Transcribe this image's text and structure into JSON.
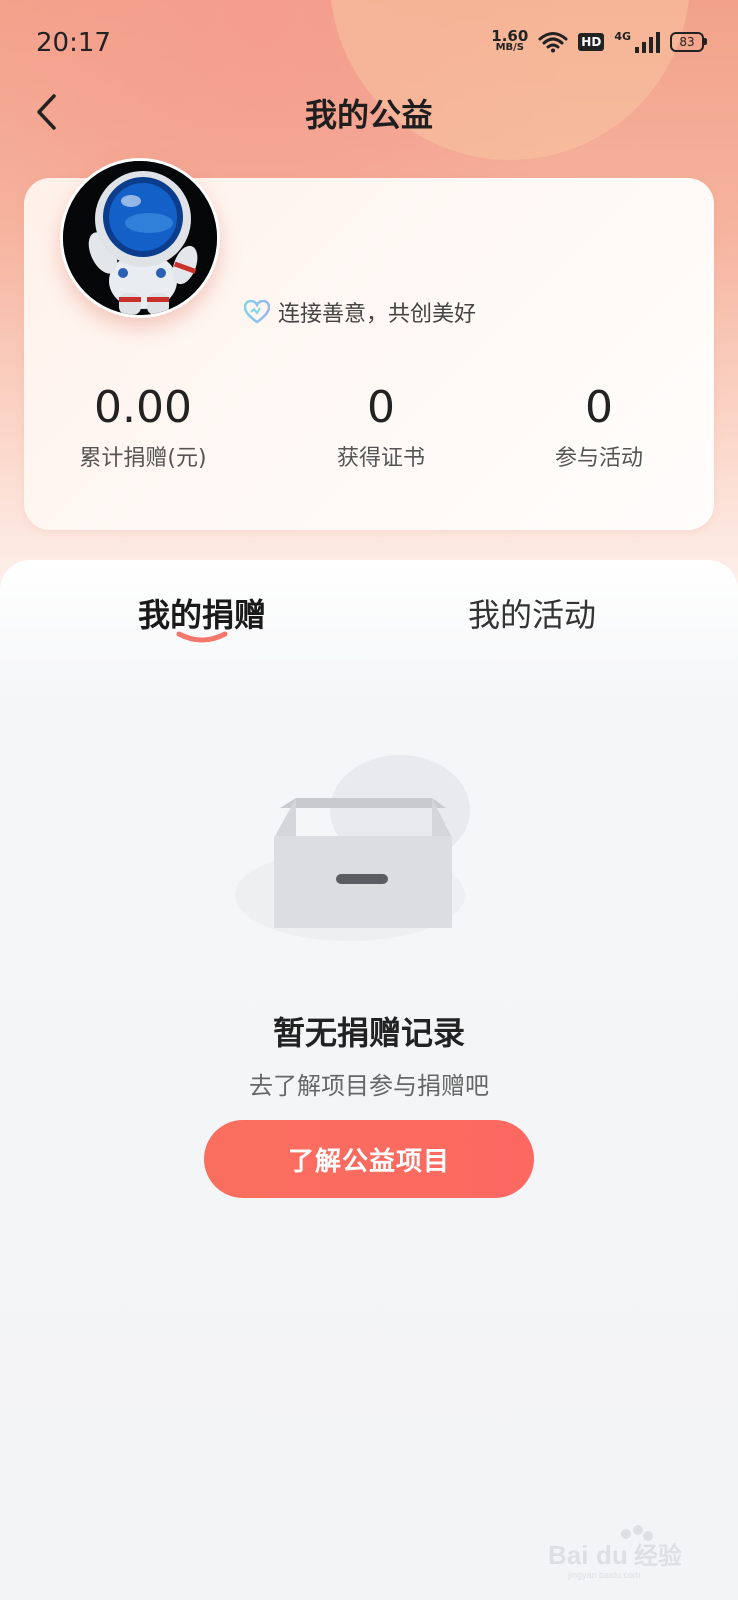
{
  "status_bar": {
    "time": "20:17",
    "speed_value": "1.60",
    "speed_unit": "MB/S",
    "hd": "HD",
    "network": "4G",
    "battery": "83"
  },
  "header": {
    "title": "我的公益"
  },
  "profile": {
    "slogan": "连接善意，共创美好",
    "stats": [
      {
        "value": "0.00",
        "label": "累计捐赠(元)"
      },
      {
        "value": "0",
        "label": "获得证书"
      },
      {
        "value": "0",
        "label": "参与活动"
      }
    ]
  },
  "tabs": [
    {
      "label": "我的捐赠",
      "active": true
    },
    {
      "label": "我的活动",
      "active": false
    }
  ],
  "empty_state": {
    "title": "暂无捐赠记录",
    "subtitle": "去了解项目参与捐赠吧",
    "button_label": "了解公益项目"
  },
  "watermark": {
    "text": "Bai du 经验",
    "sub": "jingyan.baidu.com"
  },
  "colors": {
    "accent": "#fd6861",
    "tab_indicator": "#f5766a"
  }
}
